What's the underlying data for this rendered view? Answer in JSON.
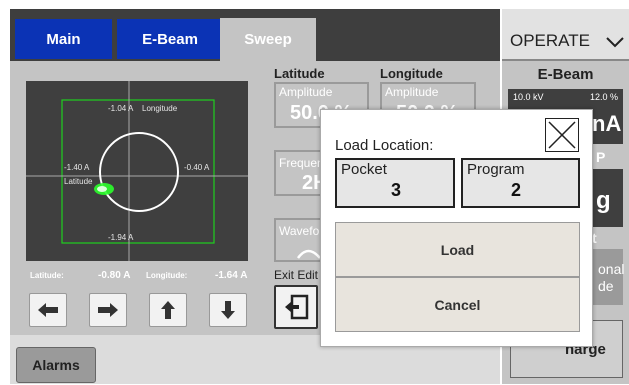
{
  "tabs": [
    {
      "label": "Main"
    },
    {
      "label": "E-Beam"
    },
    {
      "label": "Sweep"
    }
  ],
  "plot": {
    "top_label": "-1.04 A",
    "top_axis_label": "Longitude",
    "left_label": "-1.40 A",
    "left_axis_label": "Latitude",
    "right_label": "-0.40 A",
    "bottom_label": "-1.94 A"
  },
  "readouts": {
    "latitude_label": "Latitude:",
    "latitude_value": "-0.80 A",
    "longitude_label": "Longitude:",
    "longitude_value": "-1.64 A"
  },
  "sweep": {
    "latitude_header": "Latitude",
    "longitude_header": "Longitude",
    "latitude_amplitude_label": "Amplitude",
    "latitude_amplitude_value": "50.0 %",
    "longitude_amplitude_label": "Amplitude",
    "longitude_amplitude_value": "50.0 %",
    "frequency_label": "Frequen",
    "frequency_value": "2H",
    "waveform_label": "Wavefor",
    "exit_edit_label": "Exit Edit"
  },
  "operate": {
    "label": "OPERATE"
  },
  "ebeam": {
    "header": "E-Beam",
    "kv": "10.0 kV",
    "percent": "12.0 %",
    "current_partial": "nA"
  },
  "right_partial": {
    "p_letter": "P",
    "g_letter": "g",
    "t_letter": "t",
    "onal": "onal",
    "de": "de",
    "charge": "harge"
  },
  "bottom": {
    "alarms_label": "Alarms"
  },
  "dialog": {
    "title": "Load Location:",
    "pocket_label": "Pocket",
    "pocket_value": "3",
    "program_label": "Program",
    "program_value": "2",
    "load_label": "Load",
    "cancel_label": "Cancel"
  },
  "colors": {
    "tab_blue": "#0b33b5",
    "plot_border": "#1ecf1e",
    "beam_spot": "#2bff2b",
    "panel_gray": "#c4c4c4"
  }
}
